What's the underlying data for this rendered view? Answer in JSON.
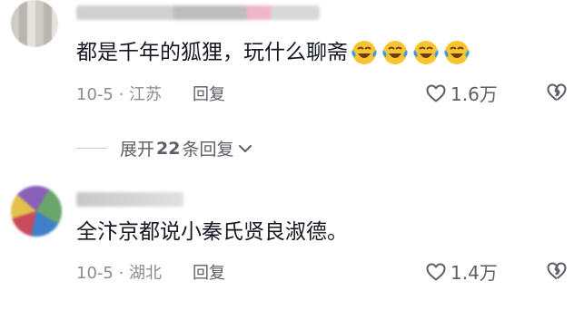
{
  "comments": [
    {
      "text": "都是千年的狐狸，玩什么聊斋",
      "emojis": [
        "laughing-tears-emoji",
        "laughing-tears-emoji",
        "laughing-tears-emoji",
        "laughing-tears-emoji"
      ],
      "date_location": "10-5 · 江苏",
      "reply_label": "回复",
      "like_count": "1.6万"
    },
    {
      "text": "全汴京都说小秦氏贤良淑德。",
      "date_location": "10-5 · 湖北",
      "reply_label": "回复",
      "like_count": "1.4万"
    }
  ],
  "expand_replies": {
    "prefix": "展开",
    "count": "22",
    "suffix": "条回复"
  },
  "icons": {
    "like": "heart-outline-icon",
    "dislike": "broken-heart-icon",
    "expand": "chevron-down-icon"
  },
  "colors": {
    "text": "#161823",
    "meta": "#8a8b91",
    "action": "#5d5e66",
    "emoji_face": "#f7c531",
    "emoji_tears": "#3c9be8"
  }
}
